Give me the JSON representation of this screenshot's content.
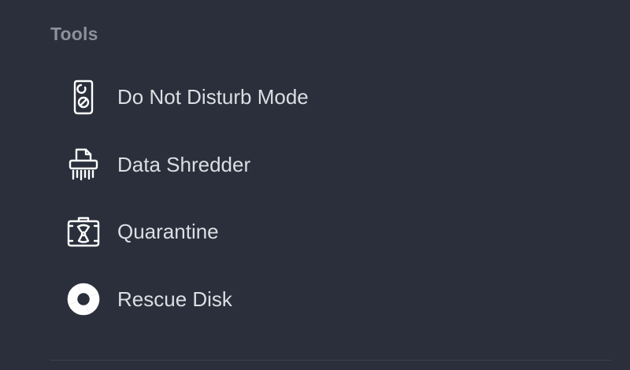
{
  "tools": {
    "title": "Tools",
    "items": [
      {
        "label": "Do Not Disturb Mode",
        "icon": "door-hanger-icon"
      },
      {
        "label": "Data Shredder",
        "icon": "shredder-icon"
      },
      {
        "label": "Quarantine",
        "icon": "quarantine-case-icon"
      },
      {
        "label": "Rescue Disk",
        "icon": "lifebuoy-icon"
      }
    ]
  },
  "colors": {
    "background": "#2a2f3b",
    "section_title": "#8b909a",
    "item_text": "#dcdee3",
    "icon": "#ffffff",
    "divider": "#3b414e"
  }
}
